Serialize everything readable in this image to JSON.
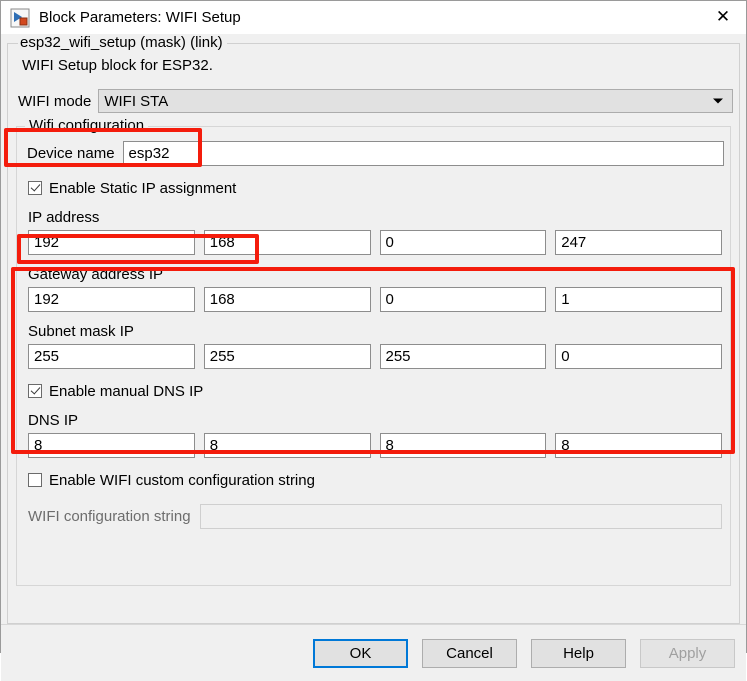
{
  "window": {
    "title": "Block Parameters: WIFI Setup",
    "icon": "simulink-block-icon",
    "close_label": "✕"
  },
  "mask": {
    "group_label": "esp32_wifi_setup (mask) (link)",
    "description": "WIFI Setup block for ESP32."
  },
  "mode": {
    "label": "WIFI mode",
    "value": "WIFI STA",
    "arrow_icon": "chevron-down-icon"
  },
  "wifi_config": {
    "group_label": "Wifi configuration",
    "device_name": {
      "label": "Device name",
      "value": "esp32"
    },
    "static_ip": {
      "label": "Enable Static IP assignment",
      "checked": true
    },
    "ip_address": {
      "label": "IP address",
      "octets": [
        "192",
        "168",
        "0",
        "247"
      ]
    },
    "gateway": {
      "label": "Gateway address IP",
      "octets": [
        "192",
        "168",
        "0",
        "1"
      ]
    },
    "subnet": {
      "label": "Subnet mask IP",
      "octets": [
        "255",
        "255",
        "255",
        "0"
      ]
    },
    "manual_dns": {
      "label": "Enable manual DNS IP",
      "checked": true
    },
    "dns_ip": {
      "label": "DNS IP",
      "octets": [
        "8",
        "8",
        "8",
        "8"
      ]
    },
    "custom_string": {
      "label": "Enable WIFI custom configuration string",
      "checked": false
    },
    "config_string": {
      "label": "WIFI configuration string",
      "value": "",
      "enabled": false
    }
  },
  "footer": {
    "ok": "OK",
    "cancel": "Cancel",
    "help": "Help",
    "apply": "Apply"
  },
  "annotations": {
    "color": "#f41c0c",
    "boxes": [
      "wifi-mode-row",
      "enable-static-ip-checkbox",
      "static-ip-fields"
    ]
  }
}
